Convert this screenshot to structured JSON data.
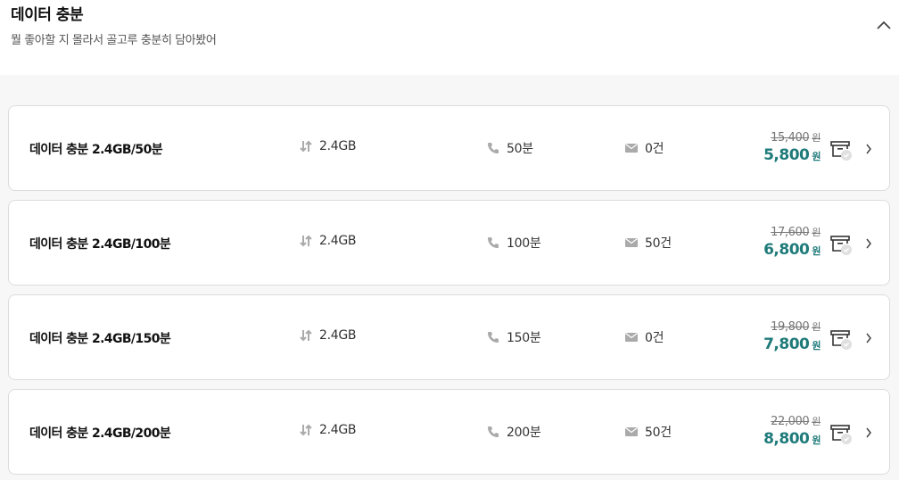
{
  "header": {
    "title": "데이터 충분",
    "subtitle": "뭘 좋아할 지 몰라서 골고루 충분히 담아봤어",
    "collapse_icon": "chevron-up-icon"
  },
  "colors": {
    "accent": "#1f7a7a",
    "background": "#f7f7f7"
  },
  "plans": [
    {
      "name": "데이터 충분 2.4GB/50분",
      "data": "2.4GB",
      "call": "50분",
      "sms": "0건",
      "original_price": "15,400",
      "price": "5,800",
      "unit": "원"
    },
    {
      "name": "데이터 충분 2.4GB/100분",
      "data": "2.4GB",
      "call": "100분",
      "sms": "50건",
      "original_price": "17,600",
      "price": "6,800",
      "unit": "원"
    },
    {
      "name": "데이터 충분 2.4GB/150분",
      "data": "2.4GB",
      "call": "150분",
      "sms": "0건",
      "original_price": "19,800",
      "price": "7,800",
      "unit": "원"
    },
    {
      "name": "데이터 충분 2.4GB/200분",
      "data": "2.4GB",
      "call": "200분",
      "sms": "50건",
      "original_price": "22,000",
      "price": "8,800",
      "unit": "원"
    }
  ]
}
